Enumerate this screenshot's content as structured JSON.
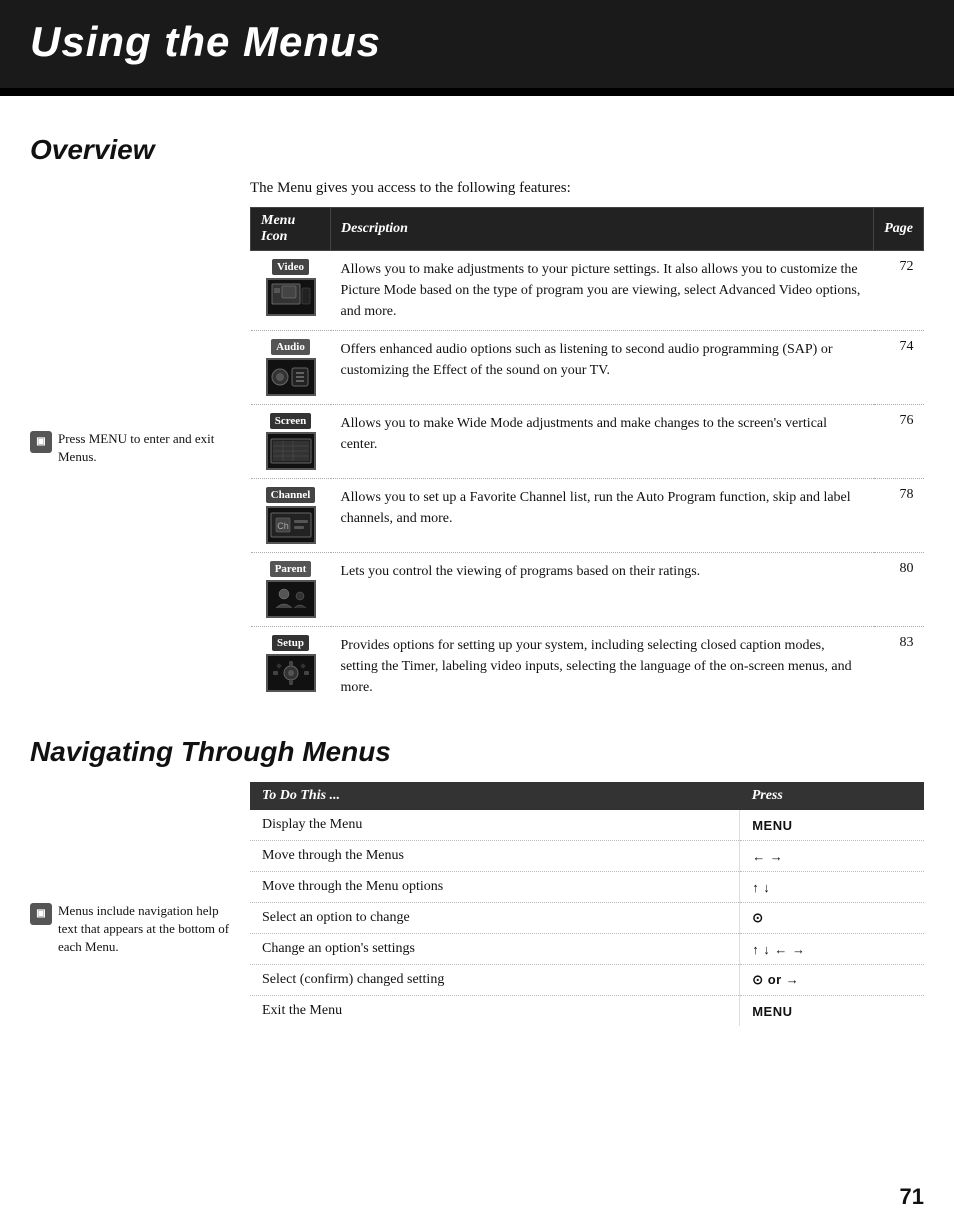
{
  "header": {
    "title": "Using the Menus"
  },
  "overview": {
    "section_title": "Overview",
    "intro": "The Menu gives you access to the following features:",
    "table_headers": {
      "icon": "Menu Icon",
      "description": "Description",
      "page": "Page"
    },
    "menu_items": [
      {
        "label": "Video",
        "label_class": "video",
        "description": "Allows you to make adjustments to your picture settings. It also allows you to customize the Picture Mode based on the type of program you are viewing, select Advanced Video options, and more.",
        "page": "72"
      },
      {
        "label": "Audio",
        "label_class": "audio",
        "description": "Offers enhanced audio options such as listening to second audio programming (SAP) or customizing the Effect of the sound on your TV.",
        "page": "74"
      },
      {
        "label": "Screen",
        "label_class": "screen",
        "description": "Allows you to make Wide Mode adjustments and make changes to the screen's vertical center.",
        "page": "76"
      },
      {
        "label": "Channel",
        "label_class": "channel",
        "description": "Allows you to set up a Favorite Channel list, run the Auto Program function, skip and label channels, and more.",
        "page": "78"
      },
      {
        "label": "Parent",
        "label_class": "parent",
        "description": "Lets you control the viewing of programs based on their ratings.",
        "page": "80"
      },
      {
        "label": "Setup",
        "label_class": "setup",
        "description": "Provides options for setting up your system, including selecting closed caption modes, setting the Timer, labeling video inputs, selecting the language of the on-screen menus, and more.",
        "page": "83"
      }
    ],
    "sidebar_note": "Press MENU to enter and exit Menus."
  },
  "nav": {
    "section_title": "Navigating Through Menus",
    "table_headers": {
      "action": "To Do This ...",
      "press": "Press"
    },
    "nav_items": [
      {
        "action": "Display the Menu",
        "press": "MENU"
      },
      {
        "action": "Move through the Menus",
        "press": "← →"
      },
      {
        "action": "Move through the Menu options",
        "press": "↑ ↓"
      },
      {
        "action": "Select an option to change",
        "press": "⊙"
      },
      {
        "action": "Change an option's settings",
        "press": "↑ ↓ ← →"
      },
      {
        "action": "Select (confirm) changed setting",
        "press": "⊙ or →"
      },
      {
        "action": "Exit the Menu",
        "press": "MENU"
      }
    ],
    "sidebar_note": "Menus include navigation help text that appears at the bottom of each Menu."
  },
  "page_number": "71"
}
